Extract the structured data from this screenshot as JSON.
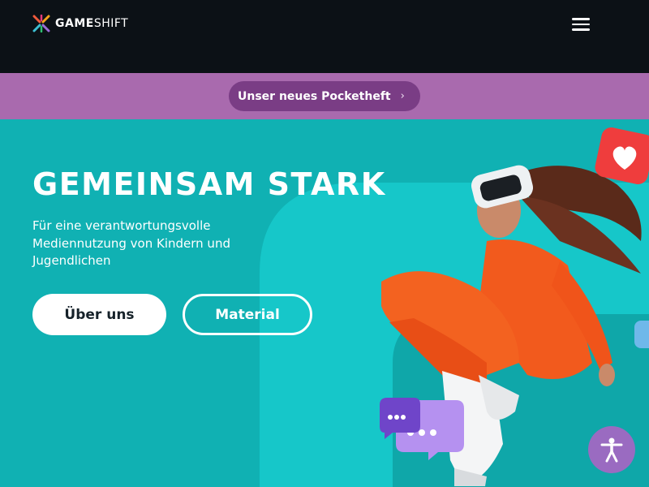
{
  "header": {
    "logo": {
      "text_bold": "GAME",
      "text_thin": "SHIFT",
      "icon": "gameshift-logo-icon"
    },
    "menu_icon": "hamburger-menu-icon"
  },
  "banner": {
    "pill_label": "Unser neues Pocketheft",
    "pill_icon": "chevron-right-icon",
    "background": "#a96aae",
    "pill_color": "#7a3d85"
  },
  "hero": {
    "title": "Gemeinsam stark",
    "subtitle": "Für eine verantwortungsvolle Mediennutzung von Kindern und Jugendlichen",
    "buttons": {
      "primary": "Über uns",
      "secondary": "Material"
    },
    "background": "#10b1b3",
    "image": "teen-with-vr-headset-image",
    "decorations": [
      "heart-bubble-icon",
      "chat-bubbles-icon"
    ]
  },
  "accessibility": {
    "icon": "accessibility-person-icon",
    "color": "#9a6bc1"
  },
  "colors": {
    "header_bg": "#0c1116",
    "accent_teal": "#10b1b3",
    "accent_purple": "#a96aae"
  }
}
